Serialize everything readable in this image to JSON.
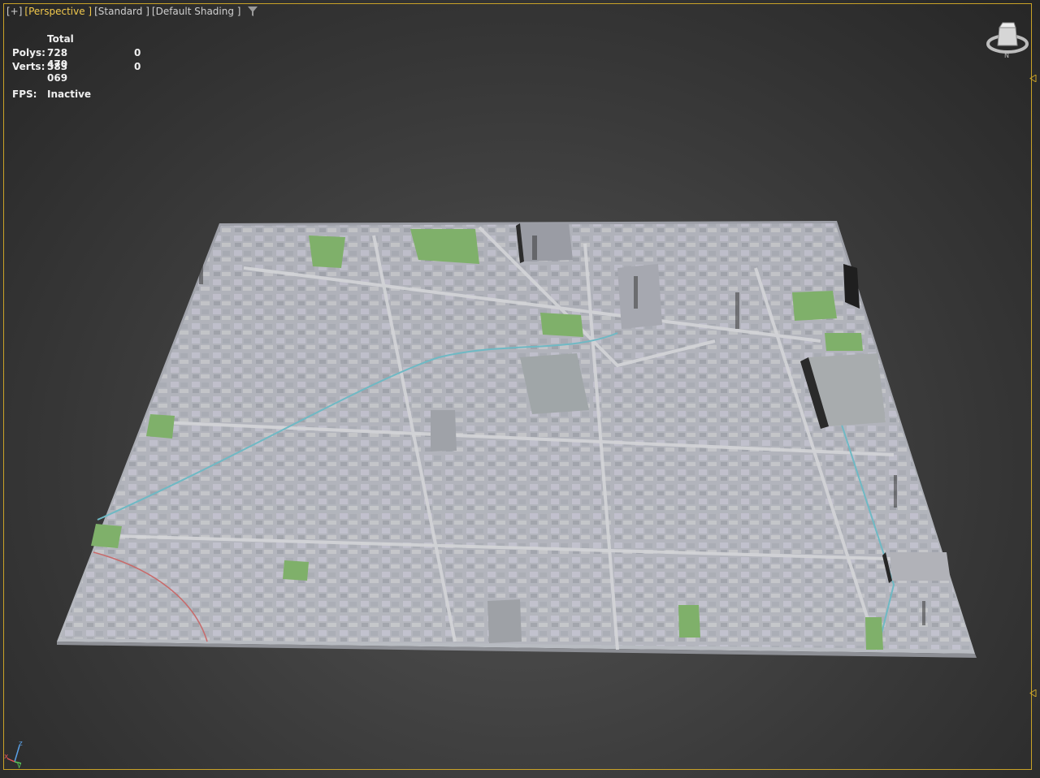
{
  "viewport": {
    "menu": {
      "plus_label": "[+]",
      "view_label": "[Perspective ]",
      "renderer_label": "[Standard ]",
      "shading_label": "[Default Shading ]"
    },
    "stats": {
      "header": "Total",
      "polys_label": "Polys:",
      "polys_total": "728 470",
      "polys_selected": "0",
      "verts_label": "Verts:",
      "verts_total": "583 069",
      "verts_selected": "0",
      "fps_label": "FPS:",
      "fps_value": "Inactive"
    },
    "viewcube": {
      "compass_label": "N",
      "icon": "viewcube-icon"
    },
    "axis_tripod": {
      "x_label": "x",
      "y_label": "y",
      "z_label": "z"
    },
    "accent_color": "#c9a227",
    "active_color": "#f2c94c",
    "scene": {
      "description_icon": "city-model",
      "ground_color": "#b6b8c0",
      "park_color": "#7fb06a",
      "water_color": "#6fb9c4"
    }
  }
}
